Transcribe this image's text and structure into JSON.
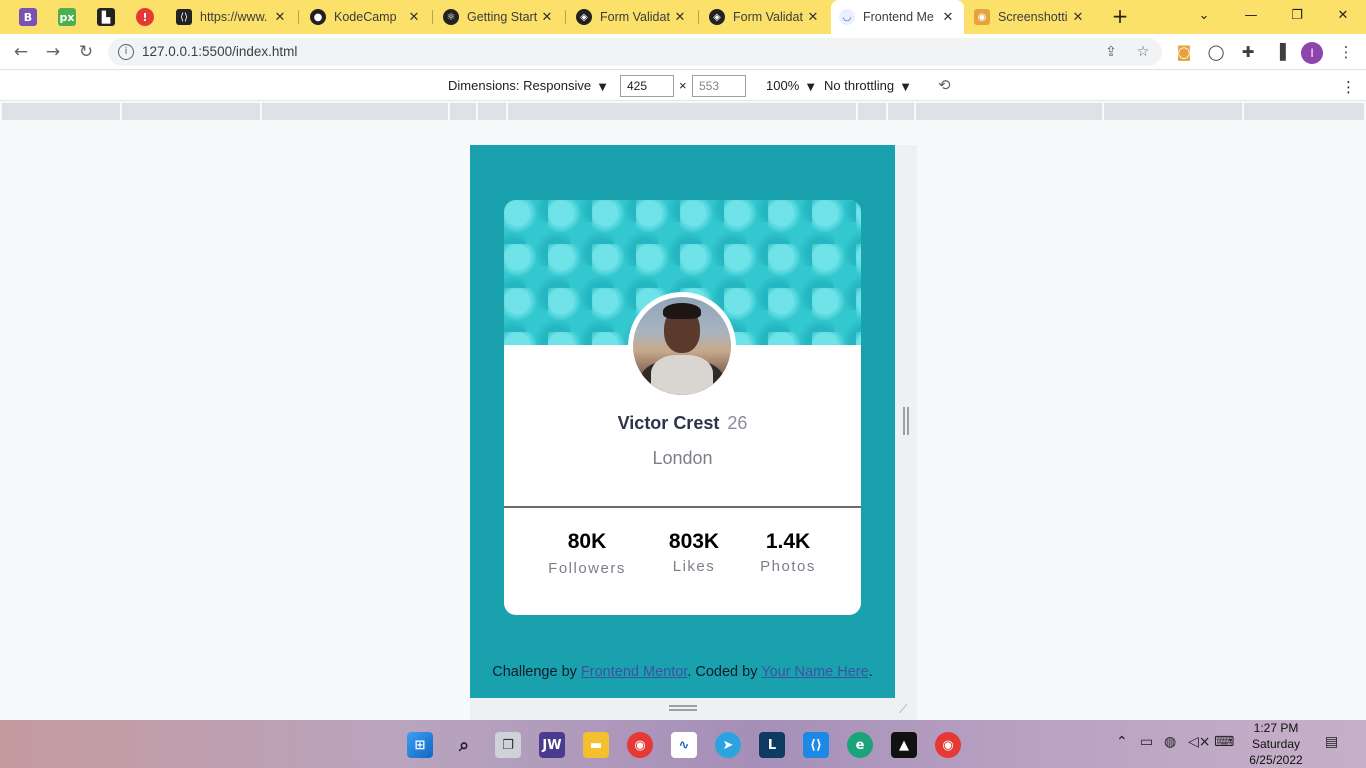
{
  "browser": {
    "pinned_tabs": [
      {
        "icon": "bootstrap-icon",
        "glyph": "B",
        "color": "#7952b3"
      },
      {
        "icon": "pixel-icon",
        "glyph": "px",
        "color": "#4caf50"
      },
      {
        "icon": "brand-icon",
        "glyph": "▙",
        "color": "#222222"
      },
      {
        "icon": "alert-icon",
        "glyph": "!",
        "color": "#e53935"
      }
    ],
    "tabs": [
      {
        "title": "https://www.",
        "icon": "web-icon",
        "glyph": "⟨⟩",
        "color": "#222222"
      },
      {
        "title": "KodeCamp",
        "icon": "github-icon",
        "glyph": "●",
        "color": "#222222"
      },
      {
        "title": "Getting Start",
        "icon": "react-icon",
        "glyph": "⚛",
        "color": "#222222"
      },
      {
        "title": "Form Validat",
        "icon": "codepen-icon",
        "glyph": "◈",
        "color": "#222222"
      },
      {
        "title": "Form Validat",
        "icon": "codepen-icon",
        "glyph": "◈",
        "color": "#222222"
      },
      {
        "title": "Frontend Me",
        "icon": "frontend-mentor-icon",
        "glyph": "◡",
        "color": "#3f54a3",
        "active": true
      },
      {
        "title": "Screenshotti",
        "icon": "screenshot-icon",
        "glyph": "◉",
        "color": "#e6a23c"
      }
    ],
    "url": "127.0.0.1:5500/index.html"
  },
  "devtools": {
    "dimensions_label": "Dimensions: Responsive",
    "width": "425",
    "times": "×",
    "height": "553",
    "zoom": "100%",
    "throttling": "No throttling"
  },
  "profile_card": {
    "name": "Victor Crest",
    "age": "26",
    "city": "London",
    "stats": [
      {
        "value": "80K",
        "label": "Followers"
      },
      {
        "value": "803K",
        "label": "Likes"
      },
      {
        "value": "1.4K",
        "label": "Photos"
      }
    ],
    "attribution": {
      "prefix": "Challenge by ",
      "link1": "Frontend Mentor",
      "middle": ". Coded by ",
      "link2": "Your Name Here",
      "suffix": "."
    }
  },
  "colors": {
    "tab_bar": "#fbe16a",
    "page_bg": "#19a2ae",
    "pattern": "#33c7cf"
  },
  "taskbar": {
    "time": "1:27 PM",
    "day": "Saturday",
    "date": "6/25/2022",
    "apps": [
      "windows-start-icon",
      "search-icon",
      "task-view-icon",
      "jw-icon",
      "file-explorer-icon",
      "chrome-icon",
      "stocks-icon",
      "telegram-icon",
      "libreoffice-icon",
      "vscode-icon",
      "edge-icon",
      "photos-icon",
      "chrome-icon"
    ]
  }
}
